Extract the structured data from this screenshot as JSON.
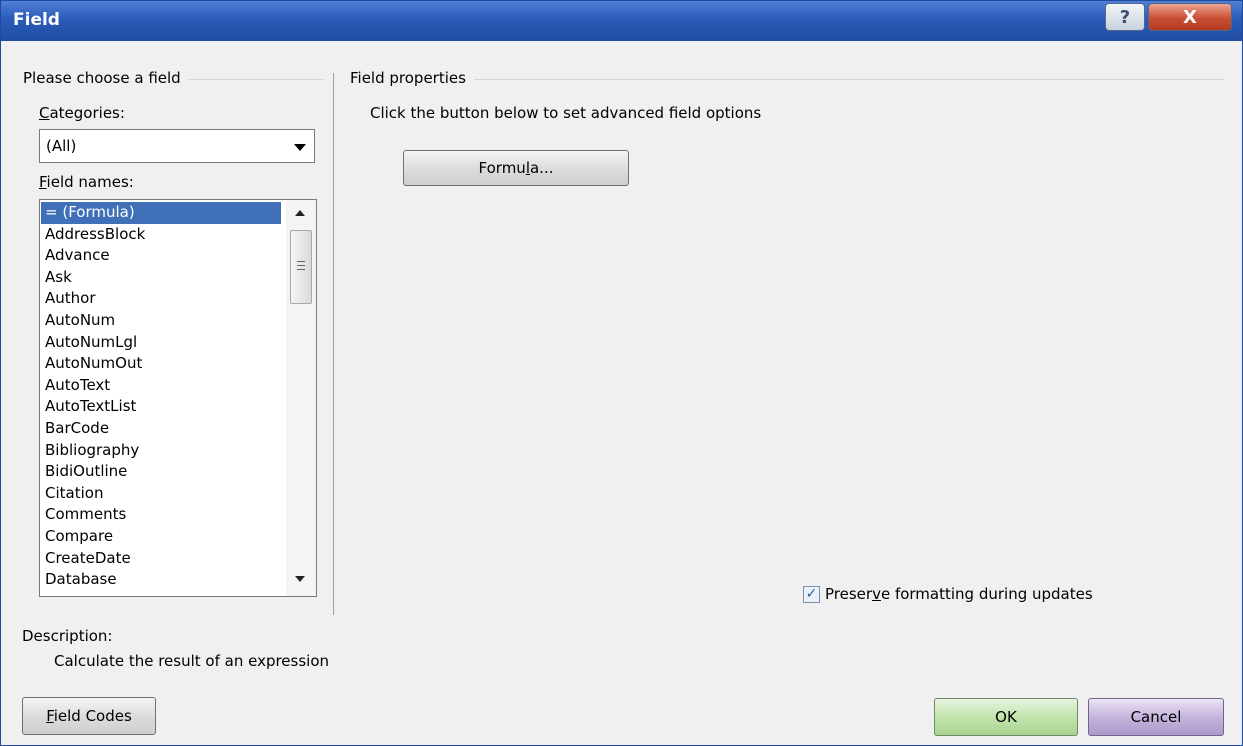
{
  "window": {
    "title": "Field",
    "help_glyph": "?",
    "close_glyph": "X"
  },
  "left": {
    "group_label": "Please choose a field",
    "categories_label": {
      "mn": "C",
      "rest": "ategories:"
    },
    "categories_value": "(All)",
    "fieldnames_label": {
      "mn": "F",
      "rest": "ield names:"
    },
    "fields": [
      "= (Formula)",
      "AddressBlock",
      "Advance",
      "Ask",
      "Author",
      "AutoNum",
      "AutoNumLgl",
      "AutoNumOut",
      "AutoText",
      "AutoTextList",
      "BarCode",
      "Bibliography",
      "BidiOutline",
      "Citation",
      "Comments",
      "Compare",
      "CreateDate",
      "Database"
    ],
    "selected_index": 0
  },
  "right": {
    "group_label": "Field properties",
    "instructions": "Click the button below to set advanced field options",
    "formula_button": {
      "pre": "Formu",
      "mn": "l",
      "post": "a..."
    },
    "preserve": {
      "pre": "Preser",
      "mn": "v",
      "post": "e formatting during updates",
      "checked": true
    }
  },
  "description": {
    "label": "Description:",
    "text": "Calculate the result of an expression"
  },
  "buttons": {
    "field_codes": {
      "mn": "F",
      "rest": "ield Codes"
    },
    "ok": "OK",
    "cancel": "Cancel"
  },
  "colors": {
    "titlebar": "#2a5bb8",
    "selection": "#3f70b8",
    "ok_button": "#c2e4ad",
    "cancel_button": "#c5b5dd"
  }
}
